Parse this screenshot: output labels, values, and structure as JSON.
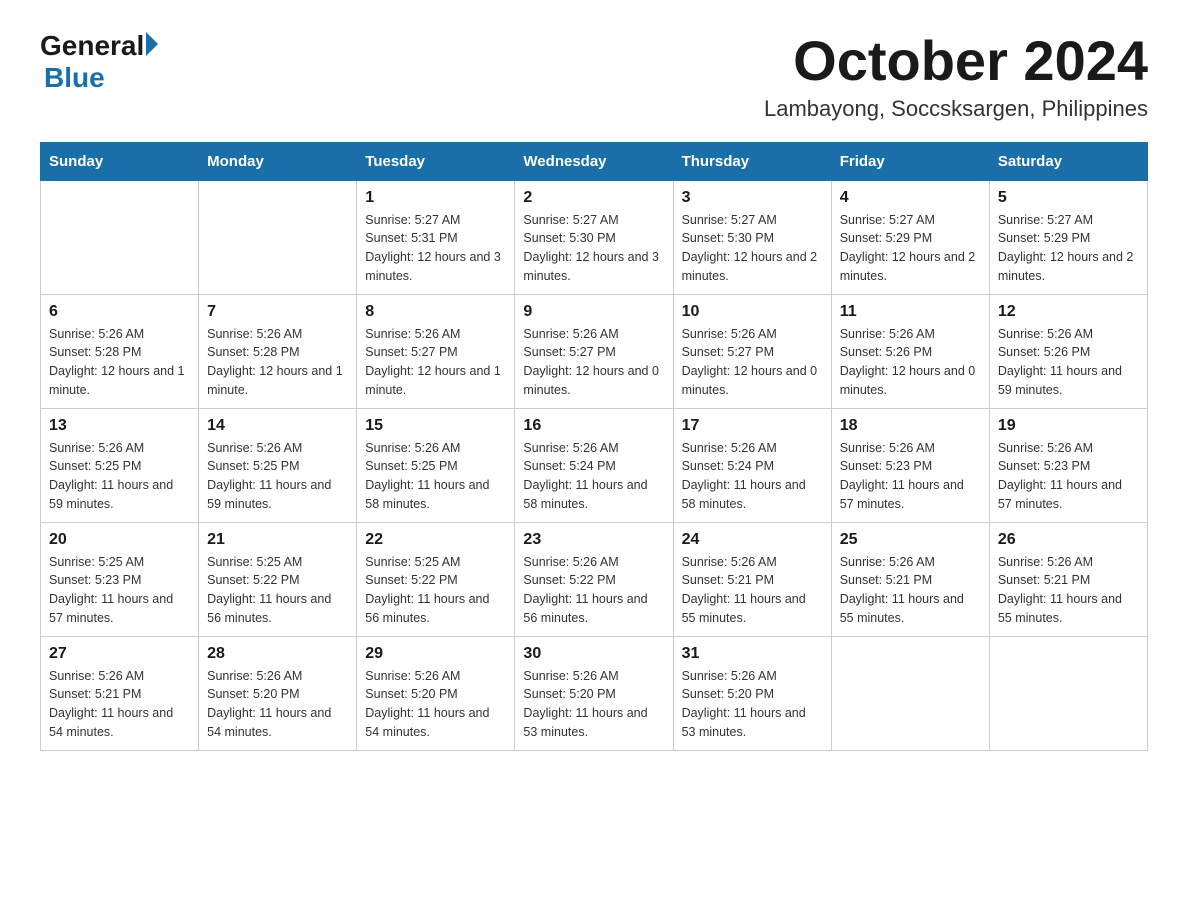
{
  "logo": {
    "general": "General",
    "blue": "Blue"
  },
  "title": "October 2024",
  "location": "Lambayong, Soccsksargen, Philippines",
  "weekdays": [
    "Sunday",
    "Monday",
    "Tuesday",
    "Wednesday",
    "Thursday",
    "Friday",
    "Saturday"
  ],
  "weeks": [
    [
      {
        "day": "",
        "sunrise": "",
        "sunset": "",
        "daylight": ""
      },
      {
        "day": "",
        "sunrise": "",
        "sunset": "",
        "daylight": ""
      },
      {
        "day": "1",
        "sunrise": "Sunrise: 5:27 AM",
        "sunset": "Sunset: 5:31 PM",
        "daylight": "Daylight: 12 hours and 3 minutes."
      },
      {
        "day": "2",
        "sunrise": "Sunrise: 5:27 AM",
        "sunset": "Sunset: 5:30 PM",
        "daylight": "Daylight: 12 hours and 3 minutes."
      },
      {
        "day": "3",
        "sunrise": "Sunrise: 5:27 AM",
        "sunset": "Sunset: 5:30 PM",
        "daylight": "Daylight: 12 hours and 2 minutes."
      },
      {
        "day": "4",
        "sunrise": "Sunrise: 5:27 AM",
        "sunset": "Sunset: 5:29 PM",
        "daylight": "Daylight: 12 hours and 2 minutes."
      },
      {
        "day": "5",
        "sunrise": "Sunrise: 5:27 AM",
        "sunset": "Sunset: 5:29 PM",
        "daylight": "Daylight: 12 hours and 2 minutes."
      }
    ],
    [
      {
        "day": "6",
        "sunrise": "Sunrise: 5:26 AM",
        "sunset": "Sunset: 5:28 PM",
        "daylight": "Daylight: 12 hours and 1 minute."
      },
      {
        "day": "7",
        "sunrise": "Sunrise: 5:26 AM",
        "sunset": "Sunset: 5:28 PM",
        "daylight": "Daylight: 12 hours and 1 minute."
      },
      {
        "day": "8",
        "sunrise": "Sunrise: 5:26 AM",
        "sunset": "Sunset: 5:27 PM",
        "daylight": "Daylight: 12 hours and 1 minute."
      },
      {
        "day": "9",
        "sunrise": "Sunrise: 5:26 AM",
        "sunset": "Sunset: 5:27 PM",
        "daylight": "Daylight: 12 hours and 0 minutes."
      },
      {
        "day": "10",
        "sunrise": "Sunrise: 5:26 AM",
        "sunset": "Sunset: 5:27 PM",
        "daylight": "Daylight: 12 hours and 0 minutes."
      },
      {
        "day": "11",
        "sunrise": "Sunrise: 5:26 AM",
        "sunset": "Sunset: 5:26 PM",
        "daylight": "Daylight: 12 hours and 0 minutes."
      },
      {
        "day": "12",
        "sunrise": "Sunrise: 5:26 AM",
        "sunset": "Sunset: 5:26 PM",
        "daylight": "Daylight: 11 hours and 59 minutes."
      }
    ],
    [
      {
        "day": "13",
        "sunrise": "Sunrise: 5:26 AM",
        "sunset": "Sunset: 5:25 PM",
        "daylight": "Daylight: 11 hours and 59 minutes."
      },
      {
        "day": "14",
        "sunrise": "Sunrise: 5:26 AM",
        "sunset": "Sunset: 5:25 PM",
        "daylight": "Daylight: 11 hours and 59 minutes."
      },
      {
        "day": "15",
        "sunrise": "Sunrise: 5:26 AM",
        "sunset": "Sunset: 5:25 PM",
        "daylight": "Daylight: 11 hours and 58 minutes."
      },
      {
        "day": "16",
        "sunrise": "Sunrise: 5:26 AM",
        "sunset": "Sunset: 5:24 PM",
        "daylight": "Daylight: 11 hours and 58 minutes."
      },
      {
        "day": "17",
        "sunrise": "Sunrise: 5:26 AM",
        "sunset": "Sunset: 5:24 PM",
        "daylight": "Daylight: 11 hours and 58 minutes."
      },
      {
        "day": "18",
        "sunrise": "Sunrise: 5:26 AM",
        "sunset": "Sunset: 5:23 PM",
        "daylight": "Daylight: 11 hours and 57 minutes."
      },
      {
        "day": "19",
        "sunrise": "Sunrise: 5:26 AM",
        "sunset": "Sunset: 5:23 PM",
        "daylight": "Daylight: 11 hours and 57 minutes."
      }
    ],
    [
      {
        "day": "20",
        "sunrise": "Sunrise: 5:25 AM",
        "sunset": "Sunset: 5:23 PM",
        "daylight": "Daylight: 11 hours and 57 minutes."
      },
      {
        "day": "21",
        "sunrise": "Sunrise: 5:25 AM",
        "sunset": "Sunset: 5:22 PM",
        "daylight": "Daylight: 11 hours and 56 minutes."
      },
      {
        "day": "22",
        "sunrise": "Sunrise: 5:25 AM",
        "sunset": "Sunset: 5:22 PM",
        "daylight": "Daylight: 11 hours and 56 minutes."
      },
      {
        "day": "23",
        "sunrise": "Sunrise: 5:26 AM",
        "sunset": "Sunset: 5:22 PM",
        "daylight": "Daylight: 11 hours and 56 minutes."
      },
      {
        "day": "24",
        "sunrise": "Sunrise: 5:26 AM",
        "sunset": "Sunset: 5:21 PM",
        "daylight": "Daylight: 11 hours and 55 minutes."
      },
      {
        "day": "25",
        "sunrise": "Sunrise: 5:26 AM",
        "sunset": "Sunset: 5:21 PM",
        "daylight": "Daylight: 11 hours and 55 minutes."
      },
      {
        "day": "26",
        "sunrise": "Sunrise: 5:26 AM",
        "sunset": "Sunset: 5:21 PM",
        "daylight": "Daylight: 11 hours and 55 minutes."
      }
    ],
    [
      {
        "day": "27",
        "sunrise": "Sunrise: 5:26 AM",
        "sunset": "Sunset: 5:21 PM",
        "daylight": "Daylight: 11 hours and 54 minutes."
      },
      {
        "day": "28",
        "sunrise": "Sunrise: 5:26 AM",
        "sunset": "Sunset: 5:20 PM",
        "daylight": "Daylight: 11 hours and 54 minutes."
      },
      {
        "day": "29",
        "sunrise": "Sunrise: 5:26 AM",
        "sunset": "Sunset: 5:20 PM",
        "daylight": "Daylight: 11 hours and 54 minutes."
      },
      {
        "day": "30",
        "sunrise": "Sunrise: 5:26 AM",
        "sunset": "Sunset: 5:20 PM",
        "daylight": "Daylight: 11 hours and 53 minutes."
      },
      {
        "day": "31",
        "sunrise": "Sunrise: 5:26 AM",
        "sunset": "Sunset: 5:20 PM",
        "daylight": "Daylight: 11 hours and 53 minutes."
      },
      {
        "day": "",
        "sunrise": "",
        "sunset": "",
        "daylight": ""
      },
      {
        "day": "",
        "sunrise": "",
        "sunset": "",
        "daylight": ""
      }
    ]
  ]
}
